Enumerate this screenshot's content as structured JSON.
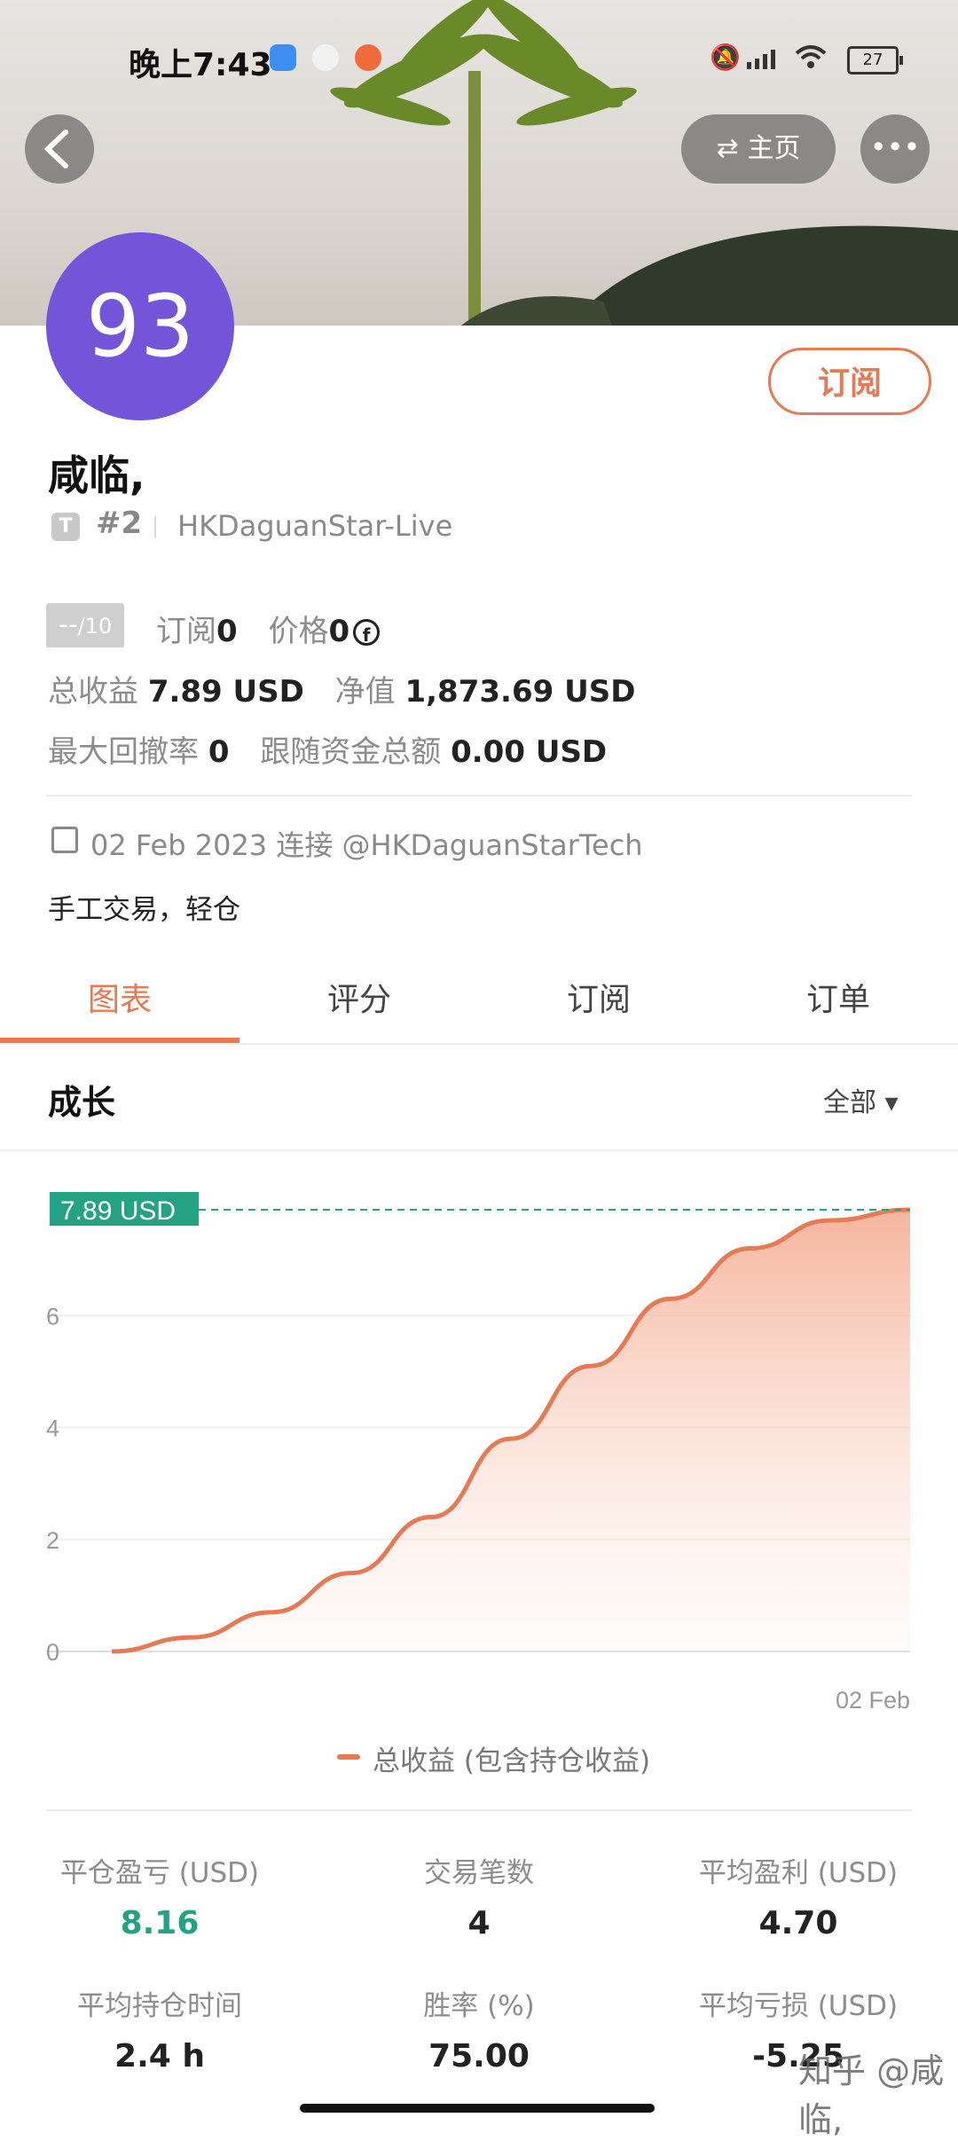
{
  "status": {
    "time": "晚上7:43",
    "battery": "27"
  },
  "header": {
    "home_label": "主页",
    "more_label": "•••"
  },
  "profile": {
    "avatar_text": "93",
    "subscribe_label": "订阅",
    "name": "咸临,",
    "badge": "T",
    "rank": "#2",
    "broker": "HKDaguanStar-Live",
    "score": "--",
    "score_max": "/10",
    "sub_label": "订阅",
    "sub_value": "0",
    "price_label": "价格",
    "price_value": "0",
    "total_profit_label": "总收益",
    "total_profit_value": "7.89 USD",
    "equity_label": "净值",
    "equity_value": "1,873.69 USD",
    "max_drawdown_label": "最大回撤率",
    "max_drawdown_value": "0",
    "follow_funds_label": "跟随资金总额",
    "follow_funds_value": "0.00 USD",
    "connected": "02 Feb 2023 连接 @HKDaguanStarTech",
    "bio": "手工交易，轻仓"
  },
  "tabs": [
    "图表",
    "评分",
    "订阅",
    "订单"
  ],
  "section": {
    "title": "成长",
    "filter": "全部"
  },
  "chart_data": {
    "type": "area",
    "series": [
      {
        "name": "总收益 (包含持仓收益)",
        "x": [
          0,
          0.1,
          0.2,
          0.3,
          0.4,
          0.5,
          0.6,
          0.7,
          0.8,
          0.9,
          1.0
        ],
        "values": [
          0,
          0.25,
          0.7,
          1.4,
          2.4,
          3.8,
          5.1,
          6.3,
          7.2,
          7.7,
          7.89
        ]
      }
    ],
    "x_ticks": [
      "02 Feb"
    ],
    "y_ticks": [
      0,
      2,
      4,
      6
    ],
    "ylim": [
      0,
      7.89
    ],
    "current_label": "7.89 USD",
    "legend": "总收益 (包含持仓收益)"
  },
  "stats": [
    {
      "label": "平仓盈亏 (USD)",
      "value": "8.16"
    },
    {
      "label": "交易笔数",
      "value": "4"
    },
    {
      "label": "平均盈利 (USD)",
      "value": "4.70"
    },
    {
      "label": "平均持仓时间",
      "value": "2.4 h"
    },
    {
      "label": "胜率 (%)",
      "value": "75.00"
    },
    {
      "label": "平均亏损 (USD)",
      "value": "-5.25"
    }
  ],
  "watermark": "知乎 @咸临,",
  "colors": {
    "accent": "#e57a55",
    "avatar": "#7454d8",
    "teal": "#23a383"
  }
}
